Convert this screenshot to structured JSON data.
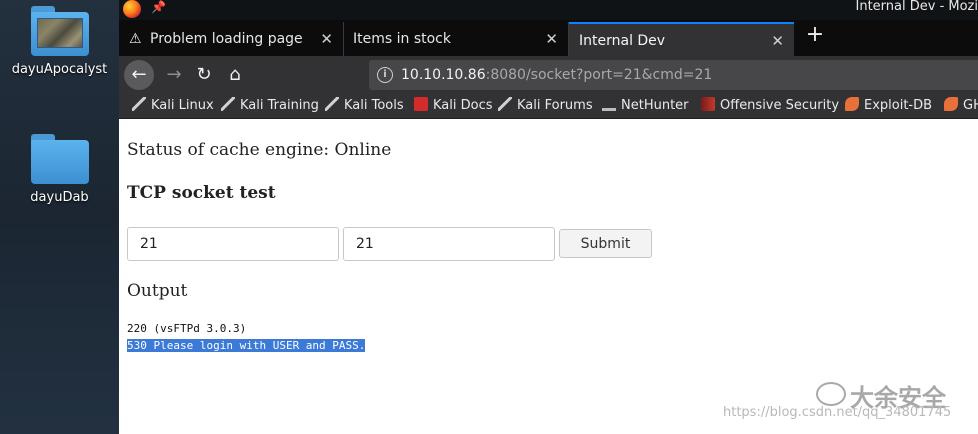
{
  "desktop": {
    "icons": [
      {
        "label": "dayuApocalyst",
        "icon": "folder-image-icon"
      },
      {
        "label": "dayuDab",
        "icon": "folder-icon"
      }
    ]
  },
  "browser": {
    "window_title": "Internal Dev - Mozi",
    "tabs": [
      {
        "label": "Problem loading page",
        "icon": "warning-icon",
        "active": false
      },
      {
        "label": "Items in stock",
        "active": false
      },
      {
        "label": "Internal Dev",
        "active": true
      }
    ],
    "url": {
      "host": "10.10.10.86",
      "rest": ":8080/socket?port=21&cmd=21"
    },
    "bookmarks": [
      {
        "label": "Kali Linux",
        "icon": "kali-dragon-icon"
      },
      {
        "label": "Kali Training",
        "icon": "kali-dragon-icon"
      },
      {
        "label": "Kali Tools",
        "icon": "kali-dragon-icon"
      },
      {
        "label": "Kali Docs",
        "icon": "kali-docs-icon"
      },
      {
        "label": "Kali Forums",
        "icon": "kali-dragon-icon"
      },
      {
        "label": "NetHunter",
        "icon": "nethunter-icon"
      },
      {
        "label": "Offensive Security",
        "icon": "offsec-icon"
      },
      {
        "label": "Exploit-DB",
        "icon": "exploit-db-icon"
      },
      {
        "label": "GH",
        "icon": "ghdb-icon"
      }
    ]
  },
  "page": {
    "status": "Status of cache engine: Online",
    "heading": "TCP socket test",
    "port_value": "21",
    "cmd_value": "21",
    "submit_label": "Submit",
    "output_heading": "Output",
    "output_lines": [
      "220 (vsFTPd 3.0.3)",
      "530 Please login with USER and PASS."
    ]
  },
  "watermark": {
    "text": "大余安全",
    "url": "https://blog.csdn.net/qq_34801745"
  }
}
